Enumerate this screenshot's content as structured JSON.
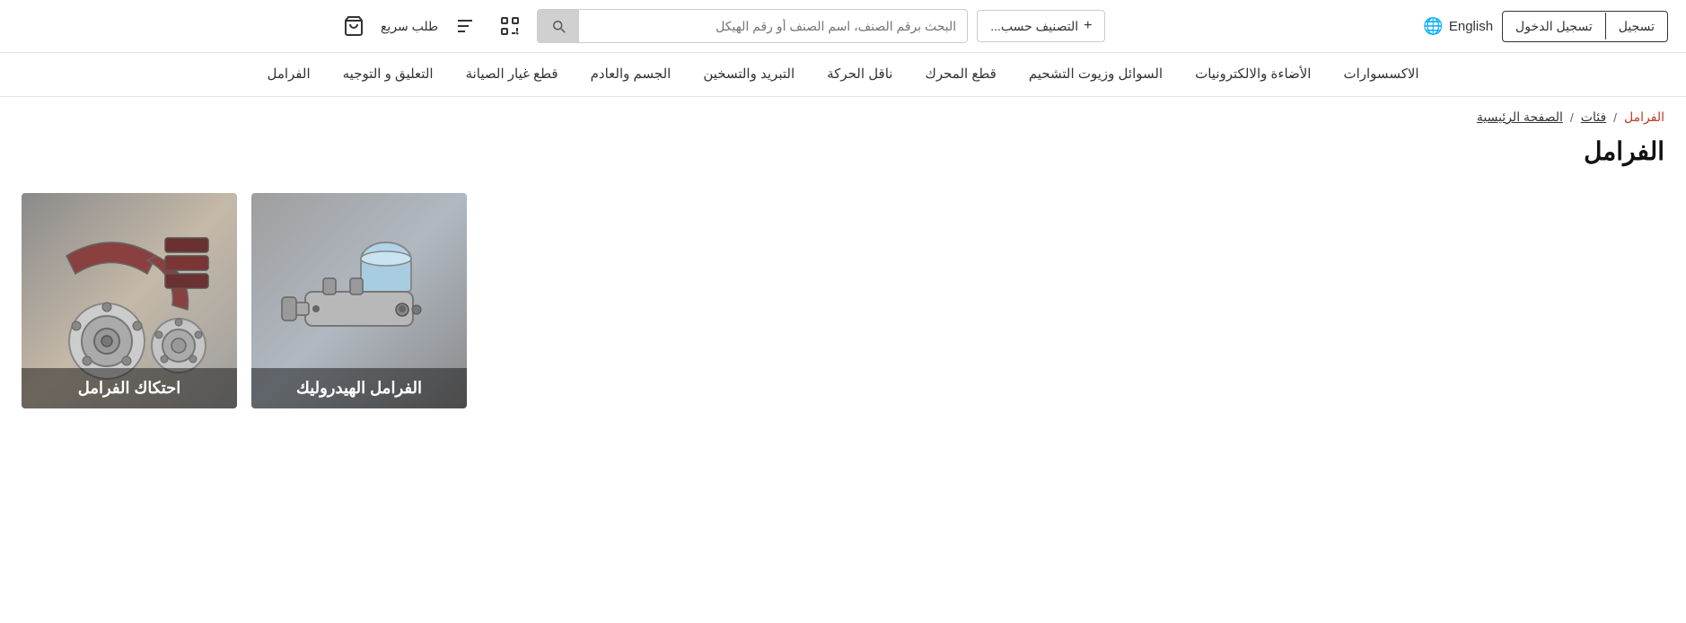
{
  "header": {
    "search_placeholder": "البحث برقم الصنف، اسم الصنف أو رقم الهيكل",
    "classify_label": "التصنيف حسب...",
    "lang_label": "English",
    "login_label": "تسجيل",
    "register_label": "تسجيل الدخول",
    "quick_order_label": "طلب سريع"
  },
  "nav": {
    "items": [
      {
        "label": "الاكسسوارات"
      },
      {
        "label": "الأضاءة والالكترونيات"
      },
      {
        "label": "السوائل وزيوت التشحيم"
      },
      {
        "label": "قطع المحرك"
      },
      {
        "label": "ناقل الحركة"
      },
      {
        "label": "التبريد والتسخين"
      },
      {
        "label": "الجسم والعادم"
      },
      {
        "label": "قطع غيار الصيانة"
      },
      {
        "label": "التعليق و التوجيه"
      },
      {
        "label": "الفرامل"
      }
    ]
  },
  "breadcrumb": {
    "home": "الصفحة الرئيسية",
    "sep1": "/",
    "categories": "فئات",
    "sep2": "/",
    "current": "الفرامل"
  },
  "page_title": "الفرامل",
  "cards": [
    {
      "id": "hydraulic",
      "label": "الفرامل الهيدروليك"
    },
    {
      "id": "friction",
      "label": "احتكاك الفرامل"
    }
  ]
}
